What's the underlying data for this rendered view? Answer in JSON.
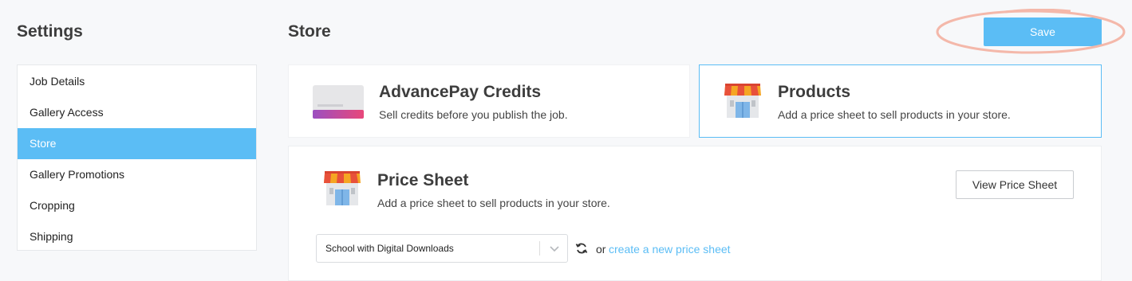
{
  "sidebar": {
    "title": "Settings",
    "items": [
      {
        "label": "Job Details",
        "active": false
      },
      {
        "label": "Gallery Access",
        "active": false
      },
      {
        "label": "Store",
        "active": true
      },
      {
        "label": "Gallery Promotions",
        "active": false
      },
      {
        "label": "Cropping",
        "active": false
      },
      {
        "label": "Shipping",
        "active": false
      }
    ]
  },
  "header": {
    "title": "Store",
    "save_label": "Save"
  },
  "cards": {
    "credits": {
      "title": "AdvancePay Credits",
      "description": "Sell credits before you publish the job.",
      "icon": "credit-card-icon"
    },
    "products": {
      "title": "Products",
      "description": "Add a price sheet to sell products in your store.",
      "icon": "storefront-icon",
      "selected": true
    }
  },
  "price_sheet": {
    "title": "Price Sheet",
    "description": "Add a price sheet to sell products in your store.",
    "view_label": "View Price Sheet",
    "select_value": "School with Digital Downloads",
    "or_text": "or",
    "create_link": "create a new price sheet"
  },
  "colors": {
    "accent": "#5bbdf5",
    "highlight_ring": "#f4b8aa",
    "awning_orange": "#f5a623",
    "awning_red": "#e8513a"
  }
}
